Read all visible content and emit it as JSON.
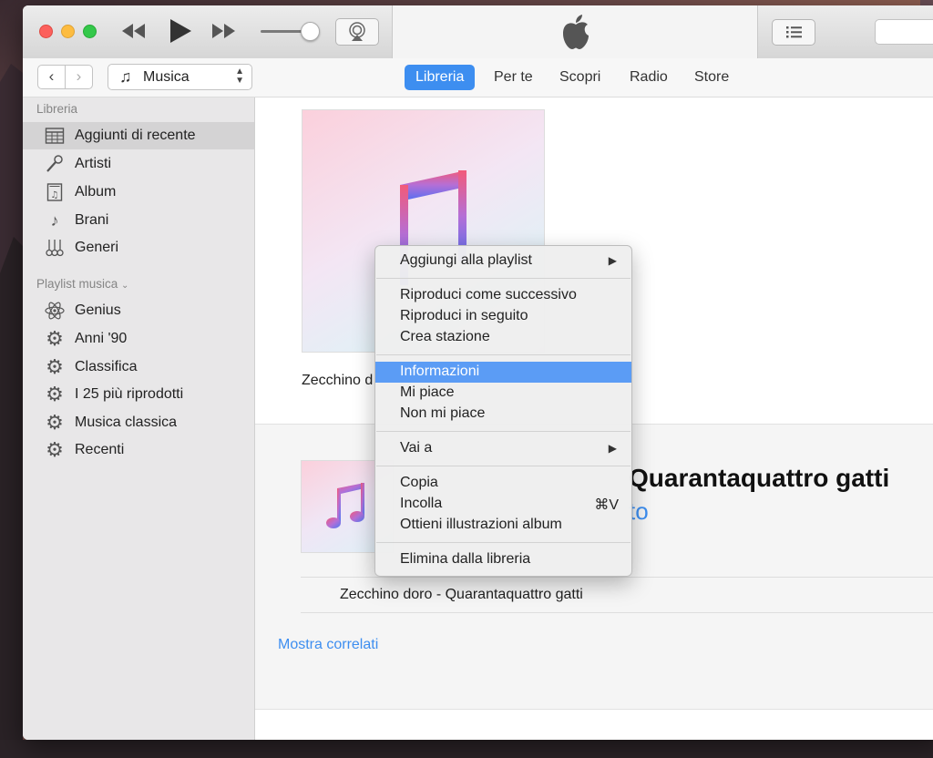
{
  "navbar": {
    "media_selector": "Musica",
    "tabs": [
      {
        "label": "Libreria",
        "active": true
      },
      {
        "label": "Per te"
      },
      {
        "label": "Scopri"
      },
      {
        "label": "Radio"
      },
      {
        "label": "Store"
      }
    ]
  },
  "sidebar": {
    "library_header": "Libreria",
    "library_items": [
      {
        "label": "Aggiunti di recente",
        "icon": "grid-calendar-icon",
        "selected": true
      },
      {
        "label": "Artisti",
        "icon": "microphone-icon"
      },
      {
        "label": "Album",
        "icon": "album-icon"
      },
      {
        "label": "Brani",
        "icon": "music-note-icon"
      },
      {
        "label": "Generi",
        "icon": "guitars-icon"
      }
    ],
    "playlist_header": "Playlist musica",
    "playlist_items": [
      {
        "label": "Genius",
        "icon": "atom-icon"
      },
      {
        "label": "Anni '90",
        "icon": "gear-icon"
      },
      {
        "label": "Classifica",
        "icon": "gear-icon"
      },
      {
        "label": "I 25 più riprodotti",
        "icon": "gear-icon"
      },
      {
        "label": "Musica classica",
        "icon": "gear-icon"
      },
      {
        "label": "Recenti",
        "icon": "gear-icon"
      }
    ]
  },
  "main": {
    "album_caption": "Zecchino d",
    "album_title": "Quarantaquattro gatti",
    "artist_fragment": "to",
    "track_title": "Zecchino doro - Quarantaquattro gatti",
    "show_related": "Mostra correlati"
  },
  "context_menu": {
    "items": [
      {
        "label": "Aggiungi alla playlist",
        "submenu": true
      },
      {
        "label": "Riproduci come successivo"
      },
      {
        "label": "Riproduci in seguito"
      },
      {
        "label": "Crea stazione"
      },
      {
        "label": "Informazioni",
        "highlighted": true
      },
      {
        "label": "Mi piace"
      },
      {
        "label": "Non mi piace"
      },
      {
        "label": "Vai a",
        "submenu": true
      },
      {
        "label": "Copia"
      },
      {
        "label": "Incolla",
        "shortcut": "⌘V"
      },
      {
        "label": "Ottieni illustrazioni album"
      },
      {
        "label": "Elimina dalla libreria"
      }
    ]
  },
  "colors": {
    "accent": "#3d8ef0",
    "highlight": "#5b9cf5"
  }
}
